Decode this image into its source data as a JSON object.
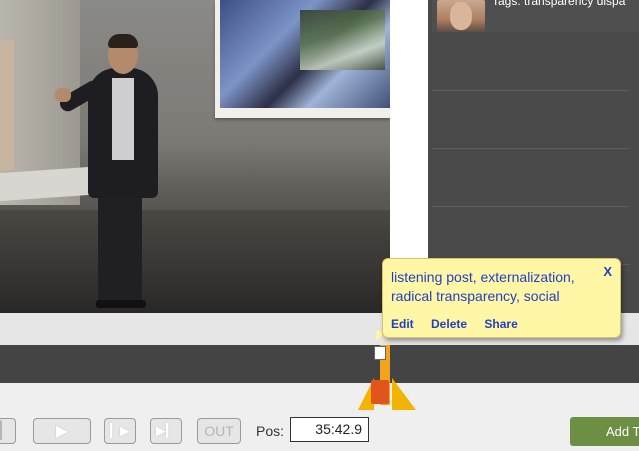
{
  "video": {
    "projection_caption": ""
  },
  "sidebar": {
    "item": {
      "tags_text": "Tags: transparency dispa"
    }
  },
  "tooltip": {
    "text": "listening post, externalization, radical transparency, social",
    "close_label": "X",
    "edit_label": "Edit",
    "delete_label": "Delete",
    "share_label": "Share"
  },
  "controls": {
    "out_label": "OUT",
    "pos_label": "Pos:",
    "pos_value": "35:42.9",
    "add_label": "Add T"
  },
  "colors": {
    "marker": "#f2b400",
    "pin": "#e0551c",
    "tooltip_bg": "#fff6a6",
    "link": "#1f3fc4",
    "add_button": "#6d8f43"
  }
}
